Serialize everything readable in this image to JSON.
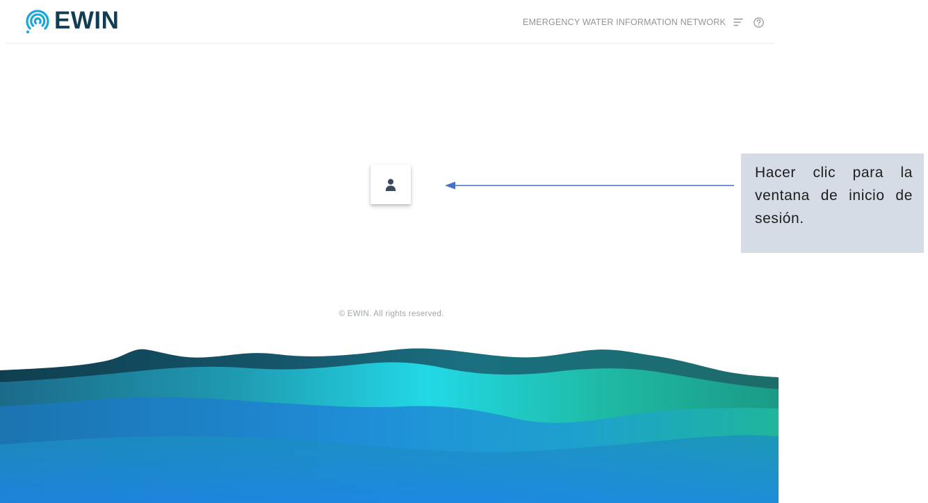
{
  "header": {
    "logo_text": "EWIN",
    "logo_icon": "ewin-spiral-icon",
    "nav_title": "EMERGENCY WATER INFORMATION NETWORK",
    "menu_icon": "menu-icon",
    "help_icon": "help-circle-icon"
  },
  "main": {
    "login_button_icon": "user-icon"
  },
  "footer": {
    "copyright": "© EWIN. All rights reserved."
  },
  "annotation": {
    "text": "Hacer clic para la ventana de inicio de sesión."
  },
  "colors": {
    "brand_navy": "#133c55",
    "brand_cyan": "#17a7d8",
    "arrow_blue": "#4472c4",
    "callout_bg": "#d6dce5"
  }
}
